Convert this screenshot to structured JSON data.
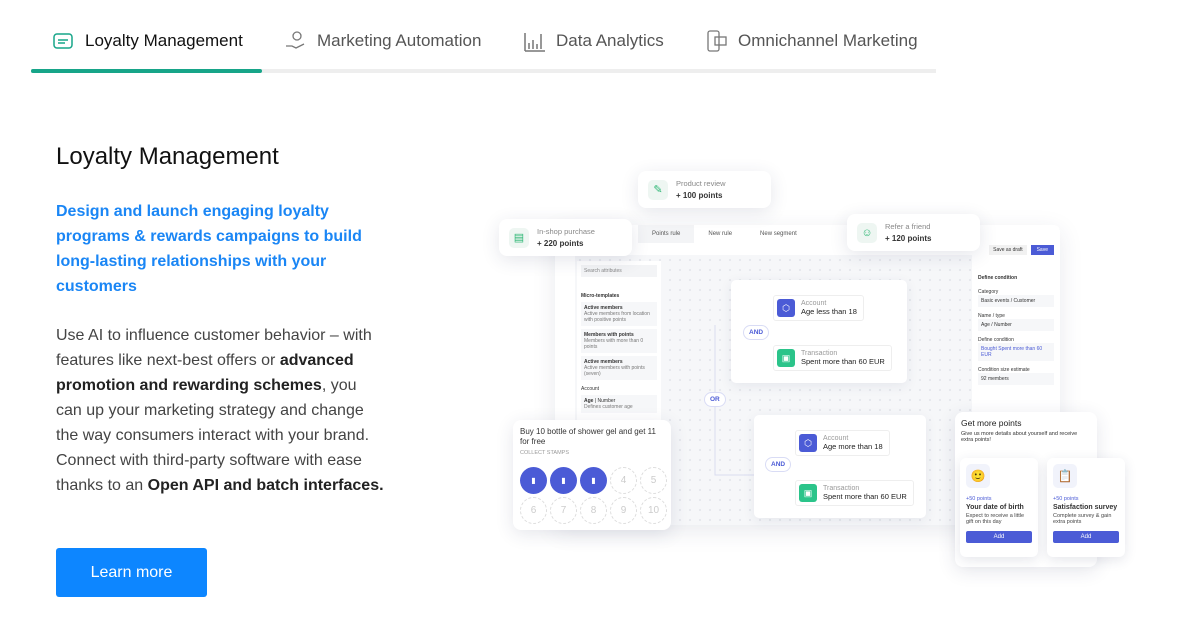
{
  "tabs": [
    {
      "label": "Loyalty Management",
      "icon": "handshake-icon",
      "active": true
    },
    {
      "label": "Marketing Automation",
      "icon": "gear-hand-icon"
    },
    {
      "label": "Data Analytics",
      "icon": "bar-chart-icon"
    },
    {
      "label": "Omnichannel Marketing",
      "icon": "store-device-icon"
    }
  ],
  "section": {
    "title": "Loyalty Management",
    "lead": "Design and launch engaging loyalty programs & rewards campaigns to build long-lasting relationships with your customers",
    "body": {
      "p1": "Use AI to influence customer behavior – with features like next-best offers or ",
      "b1": "advanced promotion and rewarding schemes",
      "p2": ", you can up your marketing strategy and change the way consumers interact with your brand. Connect with third-party software with ease thanks to an ",
      "b2": "Open API and batch interfaces."
    },
    "button": "Learn more"
  },
  "illustration": {
    "rewards": [
      {
        "label": "Product review",
        "points": "+ 100 points"
      },
      {
        "label": "In-shop purchase",
        "points": "+ 220 points"
      },
      {
        "label": "Refer a friend",
        "points": "+ 120 points"
      }
    ],
    "editor_tabs": [
      "Points rule",
      "New rule",
      "New segment"
    ],
    "save_draft": "Save as draft",
    "save": "Save",
    "search": "Search attributes",
    "templates_heading": "Micro-templates",
    "templates": [
      {
        "name": "Active members",
        "desc": "Active members from location with positive points"
      },
      {
        "name": "Members with points",
        "desc": "Members with more than 0 points"
      },
      {
        "name": "Active members",
        "desc": "Active members with points (seven)"
      }
    ],
    "account_heading": "Account",
    "account_item": {
      "name": "Age",
      "type": "Number",
      "desc": "Defines customer age"
    },
    "group1": {
      "op": "AND",
      "nodes": [
        {
          "k": "Account",
          "v": "Age less than 18"
        },
        {
          "k": "Transaction",
          "v": "Spent more than 60 EUR"
        }
      ]
    },
    "or": "OR",
    "group2": {
      "op": "AND",
      "nodes": [
        {
          "k": "Account",
          "v": "Age more than 18"
        },
        {
          "k": "Transaction",
          "v": "Spent more than 60 EUR"
        }
      ]
    },
    "conditions": {
      "title": "Define condition",
      "category_label": "Category",
      "category": "Basic events / Customer",
      "name_label": "Name / type",
      "name": "Age / Number",
      "define_label": "Define condition",
      "define": "Bought Spent more than 60 EUR",
      "estimate_label": "Condition size estimate",
      "estimate": "92 members"
    },
    "stamps": {
      "title": "Buy 10 bottle of shower gel and get 11 for free",
      "subtitle": "COLLECT STAMPS",
      "collected": 3,
      "total": 10
    },
    "more_points": {
      "title": "Get more points",
      "desc": "Give us more details about yourself and receive extra points!",
      "cards": [
        {
          "points": "+50 points",
          "title": "Your date of birth",
          "desc": "Expect to receive a little gift on this day",
          "button": "Add"
        },
        {
          "points": "+50 points",
          "title": "Satisfaction survey",
          "desc": "Complete survey & gain extra points",
          "button": "Add"
        }
      ]
    },
    "colors": {
      "accent": "#17a589",
      "link": "#1a86f5",
      "button": "#0d86ff",
      "purple": "#4b5bd6",
      "green": "#2bc48a"
    }
  }
}
